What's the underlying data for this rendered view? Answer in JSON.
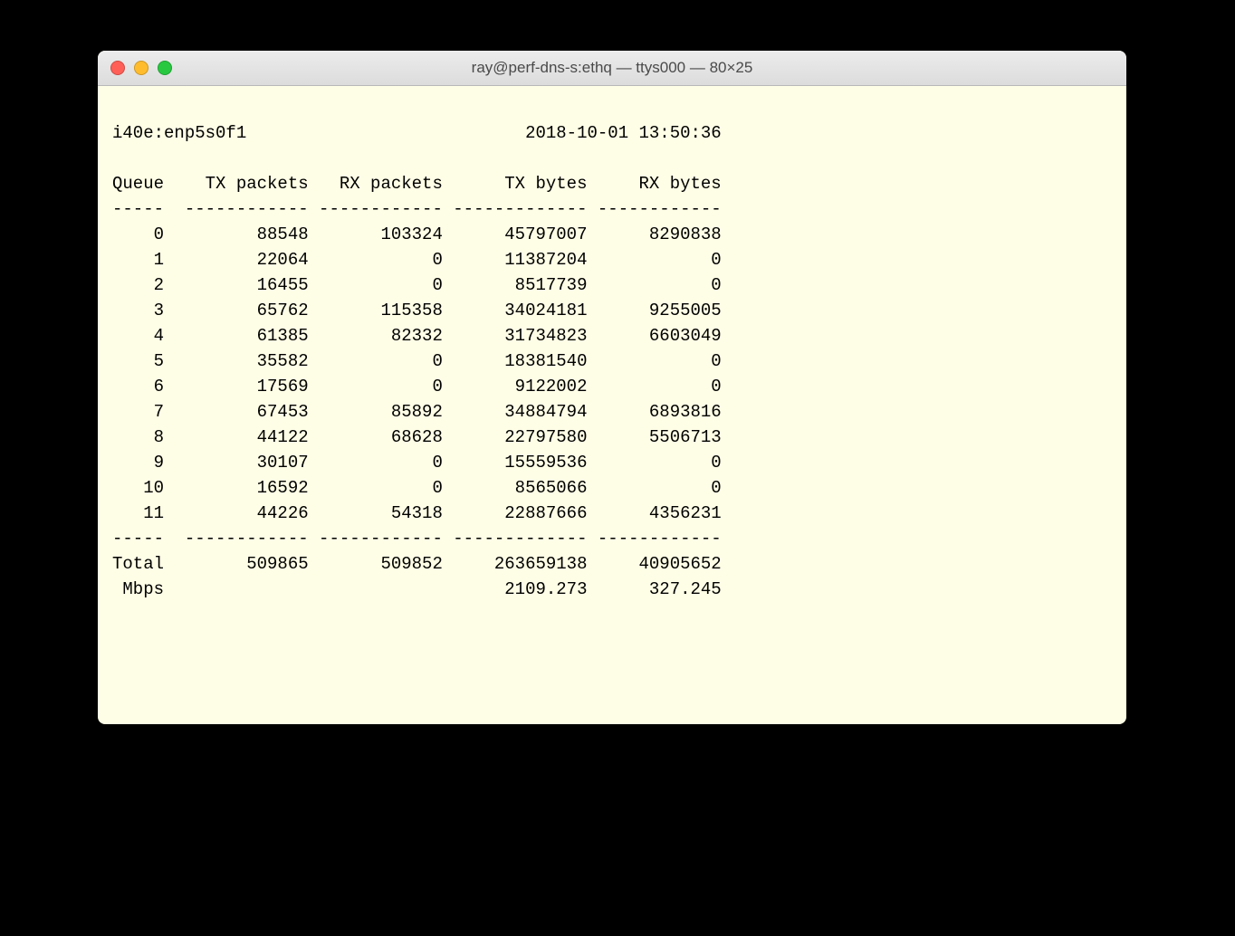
{
  "window": {
    "title": "ray@perf-dns-s:ethq — ttys000 — 80×25"
  },
  "header": {
    "interface": "i40e:enp5s0f1",
    "timestamp": "2018-10-01 13:50:36"
  },
  "columns": [
    "Queue",
    "TX packets",
    "RX packets",
    "TX bytes",
    "RX bytes"
  ],
  "rows": [
    {
      "q": "0",
      "txp": "88548",
      "rxp": "103324",
      "txb": "45797007",
      "rxb": "8290838"
    },
    {
      "q": "1",
      "txp": "22064",
      "rxp": "0",
      "txb": "11387204",
      "rxb": "0"
    },
    {
      "q": "2",
      "txp": "16455",
      "rxp": "0",
      "txb": "8517739",
      "rxb": "0"
    },
    {
      "q": "3",
      "txp": "65762",
      "rxp": "115358",
      "txb": "34024181",
      "rxb": "9255005"
    },
    {
      "q": "4",
      "txp": "61385",
      "rxp": "82332",
      "txb": "31734823",
      "rxb": "6603049"
    },
    {
      "q": "5",
      "txp": "35582",
      "rxp": "0",
      "txb": "18381540",
      "rxb": "0"
    },
    {
      "q": "6",
      "txp": "17569",
      "rxp": "0",
      "txb": "9122002",
      "rxb": "0"
    },
    {
      "q": "7",
      "txp": "67453",
      "rxp": "85892",
      "txb": "34884794",
      "rxb": "6893816"
    },
    {
      "q": "8",
      "txp": "44122",
      "rxp": "68628",
      "txb": "22797580",
      "rxb": "5506713"
    },
    {
      "q": "9",
      "txp": "30107",
      "rxp": "0",
      "txb": "15559536",
      "rxb": "0"
    },
    {
      "q": "10",
      "txp": "16592",
      "rxp": "0",
      "txb": "8565066",
      "rxb": "0"
    },
    {
      "q": "11",
      "txp": "44226",
      "rxp": "54318",
      "txb": "22887666",
      "rxb": "4356231"
    }
  ],
  "totals": {
    "label": "Total",
    "txp": "509865",
    "rxp": "509852",
    "txb": "263659138",
    "rxb": "40905652"
  },
  "mbps": {
    "label": "Mbps",
    "txb": "2109.273",
    "rxb": "327.245"
  },
  "widths": {
    "q": 5,
    "txp": 12,
    "rxp": 12,
    "txb": 13,
    "rxb": 12
  },
  "dash": "-"
}
